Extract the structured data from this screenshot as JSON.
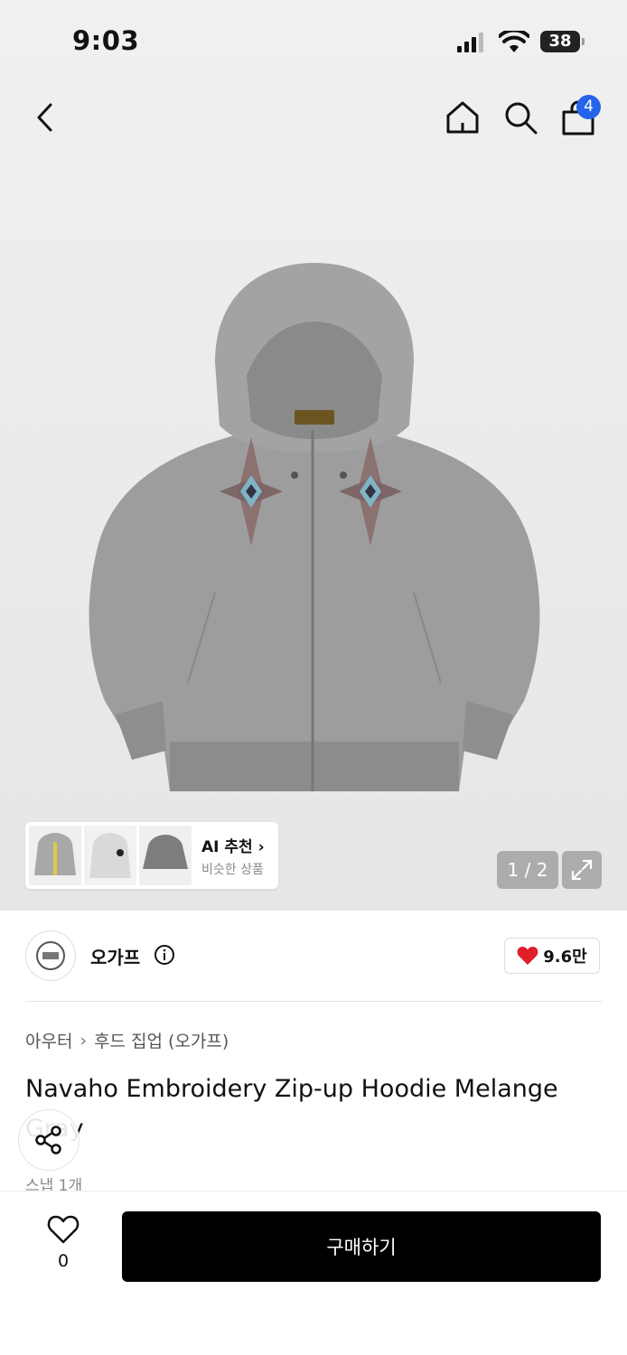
{
  "status_bar": {
    "time": "9:03",
    "battery": "38"
  },
  "header": {
    "cart_count": "4"
  },
  "ai_recommend": {
    "title": "AI 추천",
    "subtitle": "비슷한 상품"
  },
  "gallery": {
    "counter": "1 / 2"
  },
  "brand": {
    "name": "오가프",
    "likes": "9.6만"
  },
  "breadcrumb": {
    "category": "아우터",
    "subcategory": "후드 집업 (오가프)"
  },
  "product": {
    "title": "Navaho Embroidery Zip-up Hoodie Melange Gray",
    "snap_label": "스냅 1개"
  },
  "bottom_bar": {
    "wish_count": "0",
    "buy_label": "구매하기"
  },
  "colors": {
    "accent": "#2563eb",
    "heart": "#e11d2a",
    "hoodie": "#9a9a9a"
  },
  "icons": [
    "back-icon",
    "home-icon",
    "search-icon",
    "shopping-bag-icon",
    "expand-icon",
    "info-icon",
    "heart-icon",
    "share-icon"
  ]
}
